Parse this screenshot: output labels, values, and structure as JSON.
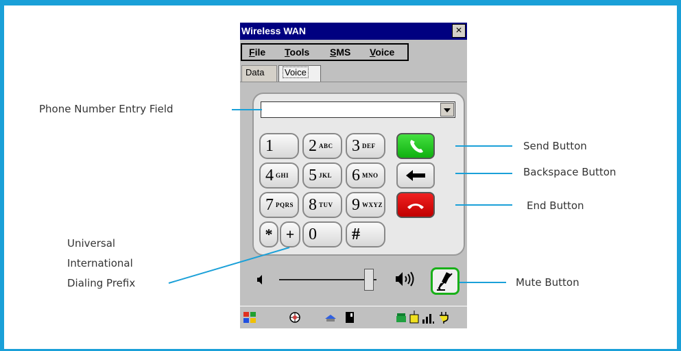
{
  "window": {
    "title": "Wireless WAN",
    "close_glyph": "×"
  },
  "menu": {
    "items": [
      "File",
      "Tools",
      "SMS",
      "Voice"
    ]
  },
  "tabs": [
    "Data",
    "Voice"
  ],
  "phone_input": {
    "value": ""
  },
  "keypad": {
    "keys": [
      {
        "digit": "1",
        "letters": ""
      },
      {
        "digit": "2",
        "letters": "ABC"
      },
      {
        "digit": "3",
        "letters": "DEF"
      },
      {
        "digit": "4",
        "letters": "GHI"
      },
      {
        "digit": "5",
        "letters": "JKL"
      },
      {
        "digit": "6",
        "letters": "MNO"
      },
      {
        "digit": "7",
        "letters": "PQRS"
      },
      {
        "digit": "8",
        "letters": "TUV"
      },
      {
        "digit": "9",
        "letters": "WXYZ"
      }
    ],
    "star": "*",
    "plus": "+",
    "zero": "0",
    "hash": "#"
  },
  "volume": {
    "level_fraction": 0.92
  },
  "callouts": {
    "phone_number": "Phone Number Entry Field",
    "send": "Send Button",
    "backspace": "Backspace Button",
    "end": "End Button",
    "prefix_line1": "Universal",
    "prefix_line2": "International",
    "prefix_line3": "Dialing Prefix",
    "mute": "Mute Button"
  },
  "colors": {
    "accent": "#1aa0d8",
    "titlebar": "#000080",
    "send": "#18b018",
    "end": "#d00000"
  }
}
